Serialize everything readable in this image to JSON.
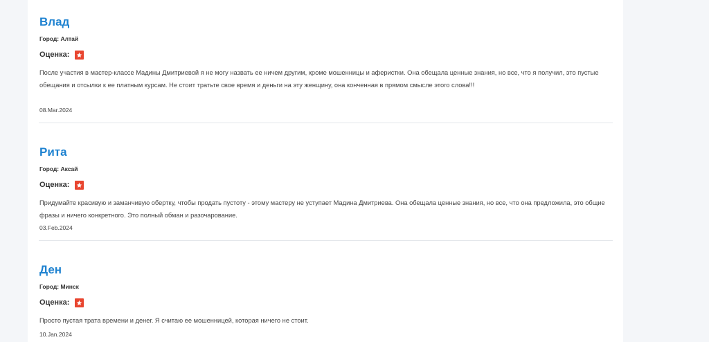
{
  "rating_label": "Оценка:",
  "accent_color": "#1e82d0",
  "star_color": "#e8452f",
  "reviews": [
    {
      "name": "Влад",
      "city": "Город: Алтай",
      "rating": 1,
      "text": "После участия в мастер-классе Мадины Дмитриевой я не могу назвать ее ничем другим, кроме мошенницы и аферистки. Она обещала ценные знания, но все, что я получил, это пустые обещания и отсылки к ее платным курсам. Не стоит тратьте свое время и деньги на эту женщину, она конченная в прямом смысле этого слова!!!",
      "date": "08.Mar.2024"
    },
    {
      "name": "Рита",
      "city": "Город: Аксай",
      "rating": 1,
      "text": "Придумайте красивую и заманчивую обертку, чтобы продать пустоту - этому мастеру не уступает Мадина Дмитриева. Она обещала ценные знания, но все, что она предложила, это общие фразы и ничего конкретного. Это полный обман и разочарование.",
      "date": "03.Feb.2024"
    },
    {
      "name": "Ден",
      "city": "Город: Минск",
      "rating": 1,
      "text": "Просто пустая трата времени и денег. Я считаю ее мошенницей, которая ничего не стоит.",
      "date": "10.Jan.2024"
    }
  ]
}
